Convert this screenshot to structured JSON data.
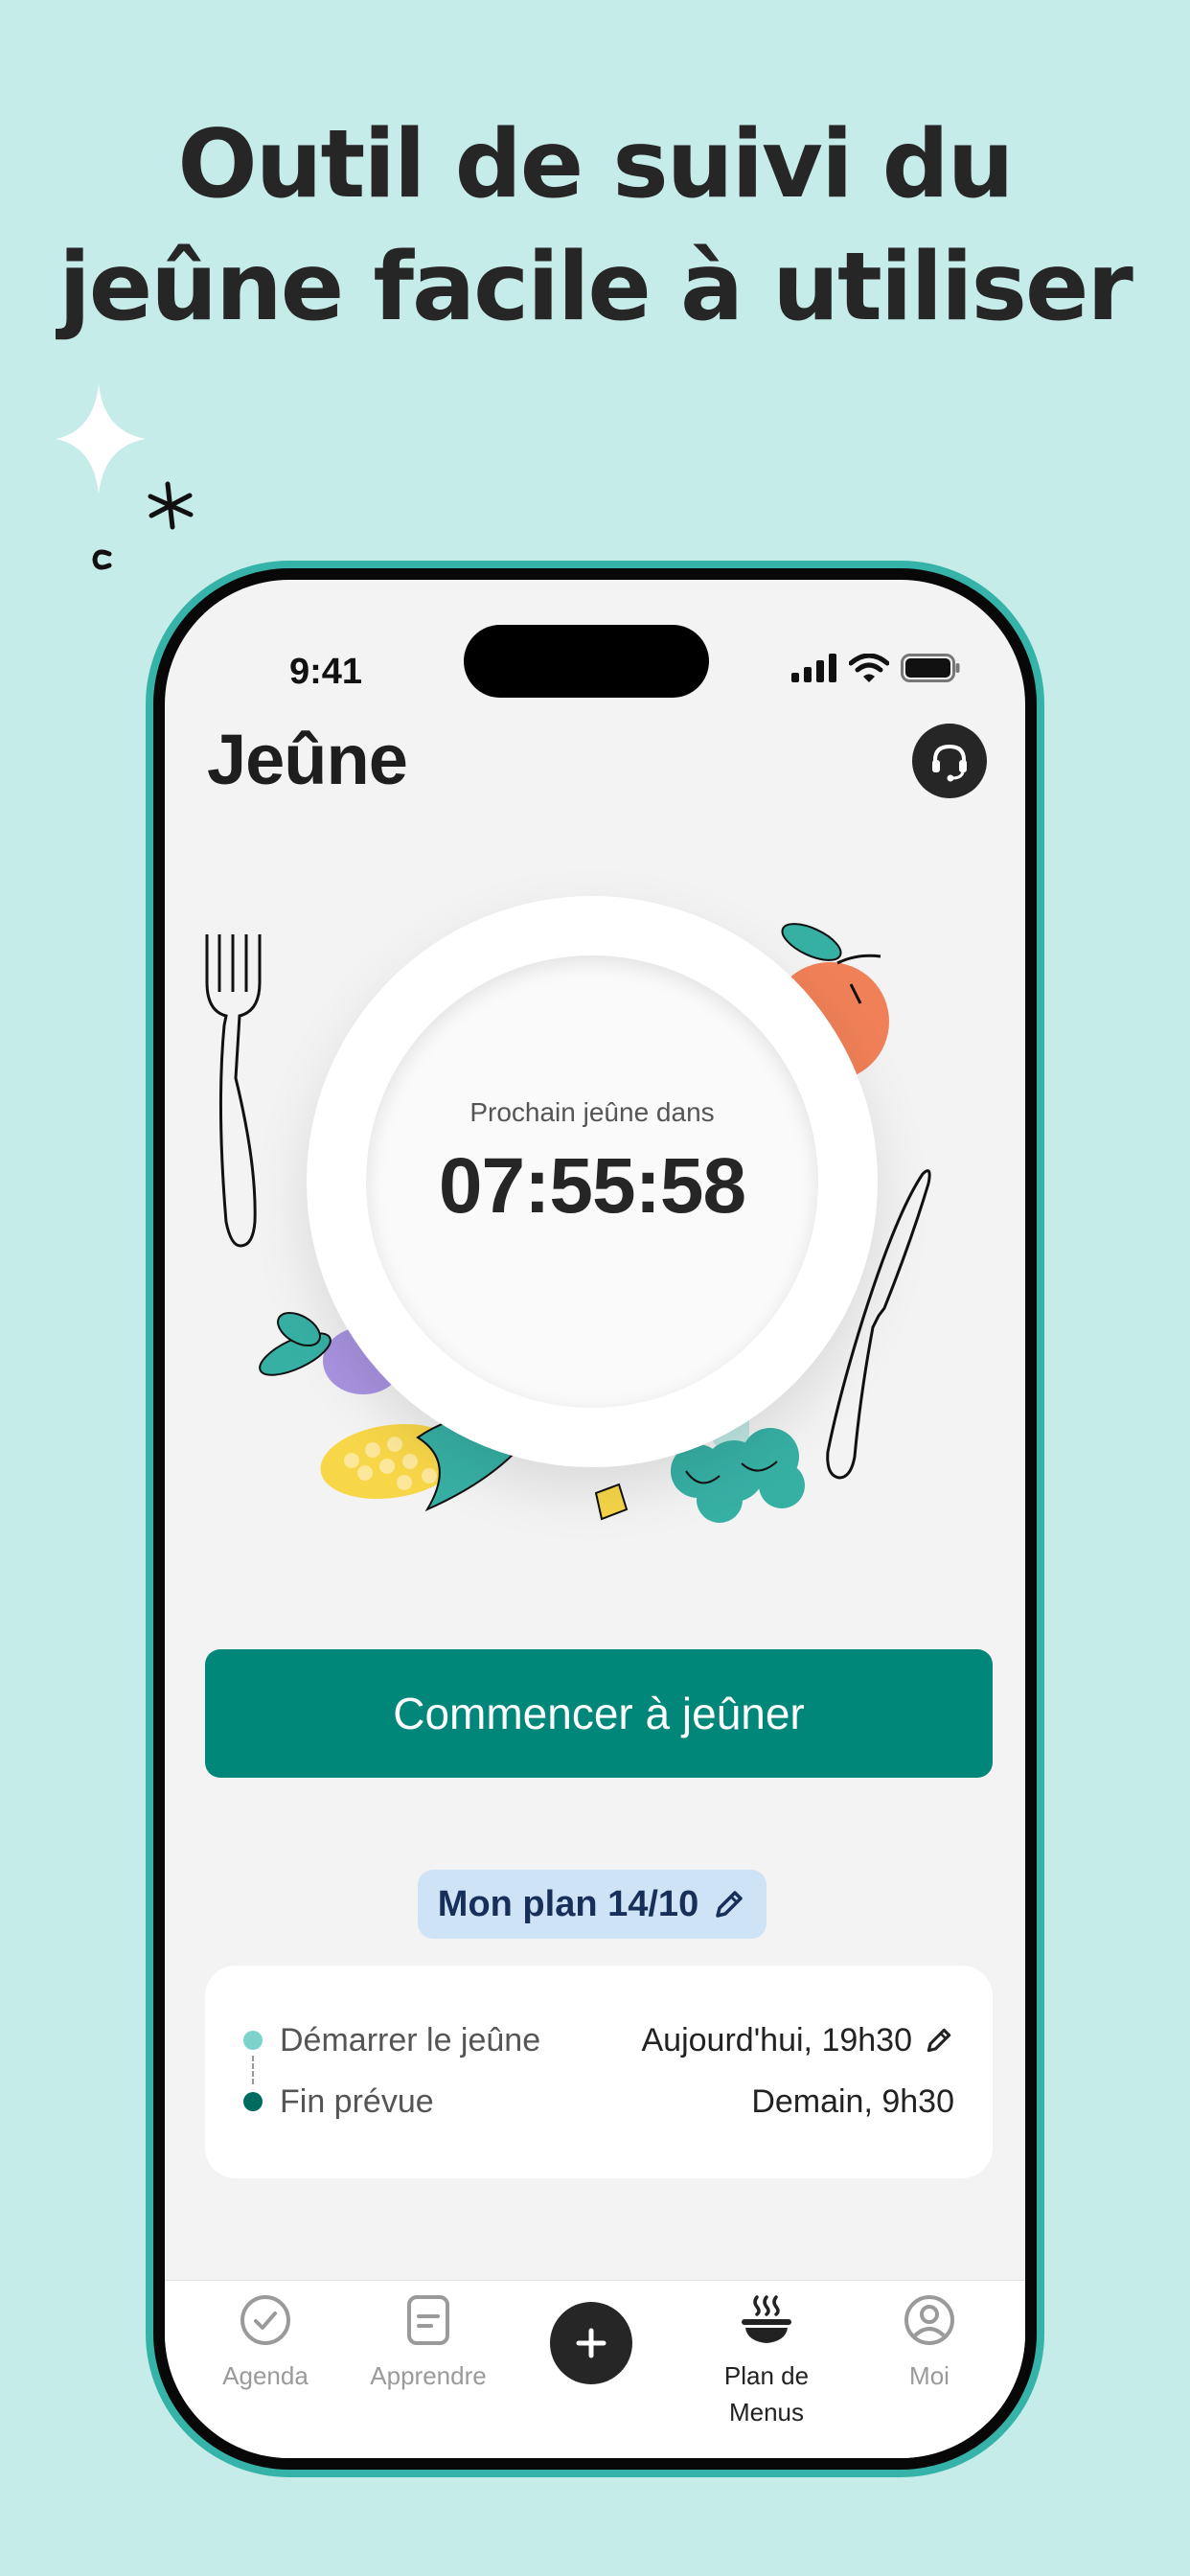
{
  "headline": {
    "line1": "Outil de suivi du",
    "line2": "jeûne facile à utiliser"
  },
  "status_bar": {
    "time": "9:41"
  },
  "app_bar": {
    "title": "Jeûne",
    "support_icon": "headset-icon"
  },
  "plate": {
    "label": "Prochain jeûne dans",
    "timer": "07:55:58"
  },
  "start_button": {
    "label": "Commencer à jeûner"
  },
  "plan_chip": {
    "label": "Mon plan 14/10",
    "icon": "pencil-icon"
  },
  "schedule": {
    "start": {
      "label": "Démarrer le jeûne",
      "value": "Aujourd'hui, 19h30"
    },
    "end": {
      "label": "Fin prévue",
      "value": "Demain, 9h30"
    }
  },
  "bottom_nav": {
    "items": [
      {
        "label": "Agenda",
        "icon": "check-circle-icon"
      },
      {
        "label": "Apprendre",
        "icon": "document-icon"
      },
      {
        "label": "",
        "icon": "plus-icon"
      },
      {
        "label": "Plan de Menus",
        "icon": "bowl-icon"
      },
      {
        "label": "Moi",
        "icon": "user-circle-icon"
      }
    ]
  },
  "colors": {
    "background": "#c5ece8",
    "phone_frame": "#35b3a8",
    "primary": "#00877a",
    "chip_bg": "#cfe3f7",
    "chip_text": "#17305a"
  }
}
